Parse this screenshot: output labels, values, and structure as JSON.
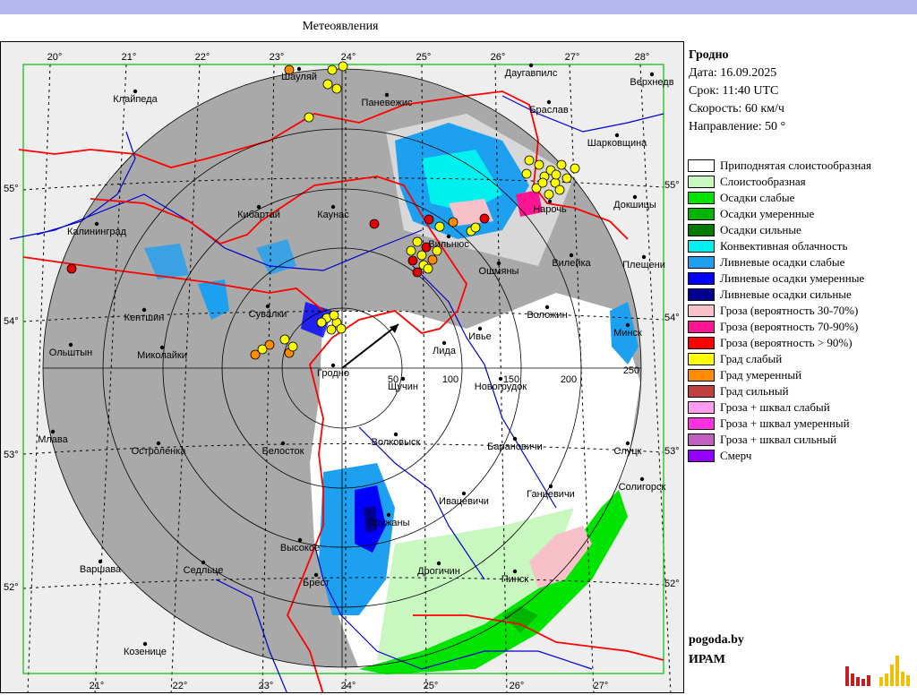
{
  "title": "Метеоявления",
  "info": {
    "station": "Гродно",
    "date": "Дата: 16.09.2025",
    "time": "Срок: 11:40 UTC",
    "speed": "Скорость: 60  км/ч",
    "direction": "Направление:  50 °"
  },
  "legend": [
    {
      "label": "Приподнятая слоистообразная",
      "color": "#ffffff"
    },
    {
      "label": "Слоистообразная",
      "color": "#c8f7c0"
    },
    {
      "label": "Осадки слабые",
      "color": "#00e400"
    },
    {
      "label": "Осадки умеренные",
      "color": "#00b400"
    },
    {
      "label": "Осадки сильные",
      "color": "#007a00"
    },
    {
      "label": "Конвективная облачность",
      "color": "#00f0f0"
    },
    {
      "label": "Ливневые осадки слабые",
      "color": "#1ea0f0"
    },
    {
      "label": "Ливневые осадки умеренные",
      "color": "#0000ff"
    },
    {
      "label": "Ливневые осадки сильные",
      "color": "#000090"
    },
    {
      "label": "Гроза (вероятность 30-70%)",
      "color": "#f8c0c8"
    },
    {
      "label": "Гроза (вероятность 70-90%)",
      "color": "#ff1493"
    },
    {
      "label": "Гроза (вероятность > 90%)",
      "color": "#ff0000"
    },
    {
      "label": "Град слабый",
      "color": "#ffff00"
    },
    {
      "label": "Град умеренный",
      "color": "#ff8c00"
    },
    {
      "label": "Град сильный",
      "color": "#c04040"
    },
    {
      "label": "Гроза + шквал слабый",
      "color": "#ff9cf0"
    },
    {
      "label": "Гроза + шквал умеренный",
      "color": "#ff30e0"
    },
    {
      "label": "Гроза + шквал сильный",
      "color": "#c060c0"
    },
    {
      "label": "Смерч",
      "color": "#9400ff"
    }
  ],
  "credits": {
    "site": "pogoda.by",
    "org": "ИРАМ"
  },
  "map": {
    "colors": {
      "radar_area": "#a9a9a9",
      "border": "#ff0000",
      "river": "#0000cc",
      "map_bg": "#eeeeee"
    },
    "lon_labels_top": [
      "20°",
      "21°",
      "22°",
      "23°",
      "24°",
      "25°",
      "26°",
      "27°",
      "28°"
    ],
    "lon_labels_bottom": [
      "21°",
      "22°",
      "23°",
      "24°",
      "25°",
      "26°",
      "27°"
    ],
    "lat_labels": [
      "55°",
      "54°",
      "53°",
      "52°"
    ],
    "range_labels": [
      "50",
      "100",
      "150",
      "200",
      "250"
    ],
    "cities": [
      {
        "name": "Клайпеда"
      },
      {
        "name": "Шауляй"
      },
      {
        "name": "Паневежис"
      },
      {
        "name": "Даугавпилс"
      },
      {
        "name": "Верхнедв"
      },
      {
        "name": "Браслав"
      },
      {
        "name": "Шарковщина"
      },
      {
        "name": "Кибартай"
      },
      {
        "name": "Каунас"
      },
      {
        "name": "Нарочь"
      },
      {
        "name": "Докшицы"
      },
      {
        "name": "Калининград"
      },
      {
        "name": "Вильнюс"
      },
      {
        "name": "Вилейка"
      },
      {
        "name": "Плещени"
      },
      {
        "name": "Ошмяны"
      },
      {
        "name": "Сувалки"
      },
      {
        "name": "Кентшин"
      },
      {
        "name": "Воложин"
      },
      {
        "name": "Минск"
      },
      {
        "name": "Ольштын"
      },
      {
        "name": "Миколайки"
      },
      {
        "name": "Ивье"
      },
      {
        "name": "Лида"
      },
      {
        "name": "Гродно"
      },
      {
        "name": "Щучин"
      },
      {
        "name": "Новогрудок"
      },
      {
        "name": "Млава"
      },
      {
        "name": "Волковыск"
      },
      {
        "name": "Остроленка"
      },
      {
        "name": "Белосток"
      },
      {
        "name": "Барановичи"
      },
      {
        "name": "Слуцк"
      },
      {
        "name": "Ганцевичи"
      },
      {
        "name": "Солигорск"
      },
      {
        "name": "Ивацевичи"
      },
      {
        "name": "Пружаны"
      },
      {
        "name": "Высокое"
      },
      {
        "name": "Варшава"
      },
      {
        "name": "Седльце"
      },
      {
        "name": "Дрогичин"
      },
      {
        "name": "Брест"
      },
      {
        "name": "Пинск"
      },
      {
        "name": "Козенице"
      }
    ]
  }
}
